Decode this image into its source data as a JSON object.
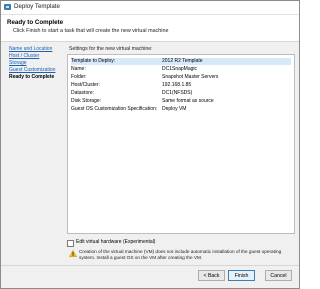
{
  "window": {
    "title": "Deploy Template"
  },
  "header": {
    "title": "Ready to Complete",
    "subtitle": "Click Finish to start a task that will create the new virtual machine"
  },
  "nav": {
    "items": [
      {
        "label": "Name and Location",
        "current": false
      },
      {
        "label": "Host / Cluster",
        "current": false
      },
      {
        "label": "Storage",
        "current": false
      },
      {
        "label": "Guest Customization",
        "current": false
      },
      {
        "label": "Ready to Complete",
        "current": true
      }
    ]
  },
  "content": {
    "heading": "Settings for the new virtual machine:",
    "settings": [
      {
        "key": "Template to Deploy:",
        "value": "2012 R2 Template"
      },
      {
        "key": "Name:",
        "value": "DC1SnapMagic"
      },
      {
        "key": "Folder:",
        "value": "Snapshot Master Servers"
      },
      {
        "key": "Host/Cluster:",
        "value": "192.168.1.85"
      },
      {
        "key": "Datastore:",
        "value": "DC1(NFSDS)"
      },
      {
        "key": "Disk Storage:",
        "value": "Same format as source"
      },
      {
        "key": "Guest OS Customization Specification:",
        "value": "Deploy VM"
      }
    ]
  },
  "checkbox": {
    "label": "Edit virtual hardware (Experimental)",
    "checked": false
  },
  "warning": {
    "text": "Creation of the virtual machine (VM) does not include automatic installation of the guest operating system. Install a guest OS on the VM after creating the VM."
  },
  "buttons": {
    "back": "< Back",
    "finish": "Finish",
    "cancel": "Cancel"
  },
  "icons": {
    "app": "vm-template-icon",
    "warning": "warning-icon"
  }
}
